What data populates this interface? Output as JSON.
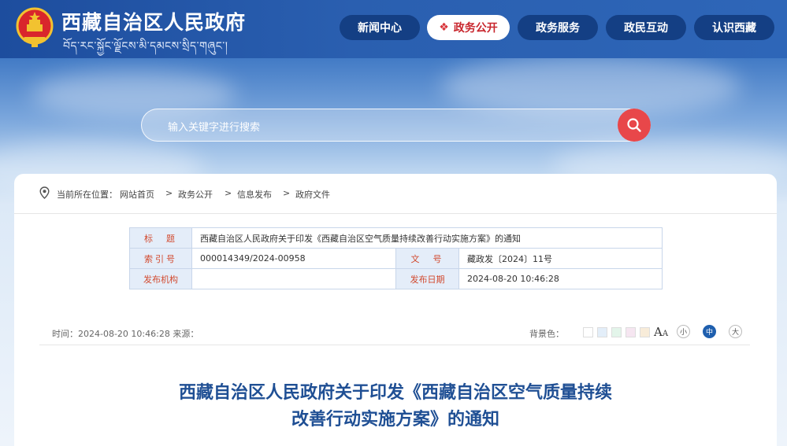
{
  "header": {
    "title": "西藏自治区人民政府",
    "subtitle": "བོད་རང་སྐྱོང་ལྗོངས་མི་དམངས་སྲིད་གཞུང་།"
  },
  "nav": [
    {
      "label": "新闻中心",
      "active": false
    },
    {
      "label": "政务公开",
      "active": true,
      "icon": "lattice-icon"
    },
    {
      "label": "政务服务",
      "active": false
    },
    {
      "label": "政民互动",
      "active": false
    },
    {
      "label": "认识西藏",
      "active": false
    }
  ],
  "search": {
    "placeholder": "输入关键字进行搜索",
    "button_icon": "search-icon"
  },
  "breadcrumb": {
    "prefix": "当前所在位置：",
    "items": [
      "网站首页",
      "政务公开",
      "信息发布",
      "政府文件"
    ],
    "separator": ">"
  },
  "meta_table": {
    "title_label": "标　题",
    "title_value": "西藏自治区人民政府关于印发《西藏自治区空气质量持续改善行动实施方案》的通知",
    "index_label": "索引号",
    "index_value": "000014349/2024-00958",
    "doc_no_label": "文　号",
    "doc_no_value": "藏政发〔2024〕11号",
    "publisher_label": "发布机构",
    "publisher_value": "",
    "date_label": "发布日期",
    "date_value": "2024-08-20 10:46:28"
  },
  "info": {
    "time_text": "时间：2024-08-20 10:46:28 来源：",
    "bg_label": "背景色：",
    "bg_colors": [
      "#ffffff",
      "#e3eef9",
      "#e3f5ea",
      "#f6e6f1",
      "#f8ecd9"
    ],
    "font_label": "A",
    "font_label_small": "A",
    "sizes": [
      {
        "label": "小",
        "active": false
      },
      {
        "label": "中",
        "active": true
      },
      {
        "label": "大",
        "active": false
      }
    ]
  },
  "article": {
    "title_line1": "西藏自治区人民政府关于印发《西藏自治区空气质量持续",
    "title_line2": "改善行动实施方案》的通知"
  },
  "colors": {
    "header_bg": "#2a5fb0",
    "nav_bg": "#143f84",
    "accent_red": "#c8262d",
    "title_blue": "#1f4f94"
  }
}
